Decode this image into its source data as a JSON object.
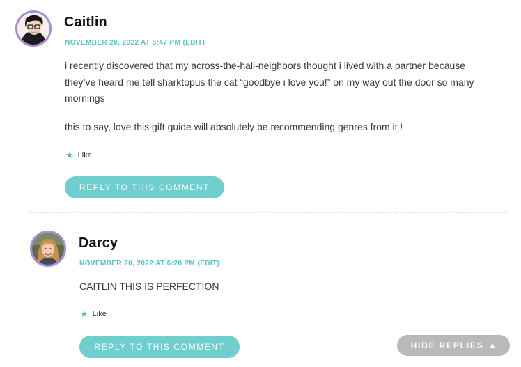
{
  "comments": [
    {
      "author": "Caitlin",
      "date": "NOVEMBER 20, 2022 AT 5:47 PM",
      "edit_label": "(EDIT)",
      "paragraphs": [
        "i recently discovered that my across-the-hall-neighbors thought i lived with a partner because they’ve heard me tell sharktopus the cat “goodbye i love you!” on my way out the door so many mornings",
        "this to say, love this gift guide will absolutely be recommending genres from it !"
      ],
      "like_label": "Like",
      "reply_label": "REPLY TO THIS COMMENT",
      "avatar_icon": "user-avatar-photo"
    },
    {
      "author": "Darcy",
      "date": "NOVEMBER 20, 2022 AT 6:20 PM",
      "edit_label": "(EDIT)",
      "paragraphs": [
        "CAITLIN THIS IS PERFECTION"
      ],
      "like_label": "Like",
      "reply_label": "REPLY TO THIS COMMENT",
      "avatar_icon": "user-avatar-photo"
    }
  ],
  "hide_replies_label": "HIDE REPLIES",
  "hide_replies_icon": "triangle-up-icon",
  "like_icon": "star-icon",
  "colors": {
    "accent": "#55c6c6",
    "button": "#6fcfce",
    "avatar_border": "#a98bdd",
    "hide_button": "#b9b9b9",
    "like_star": "#4ab6c8"
  }
}
